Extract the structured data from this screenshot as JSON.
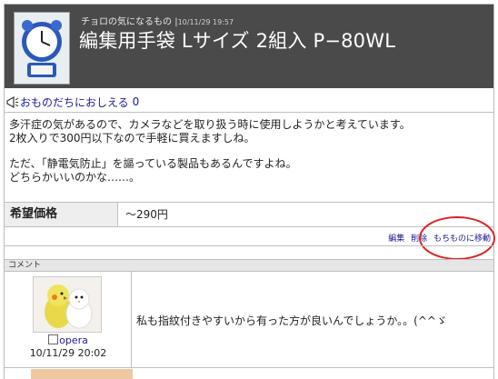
{
  "header": {
    "author": "チョロの気になるもの",
    "date": "10/11/29 19:57",
    "title": "編集用手袋 Lサイズ 2組入 P−80WL"
  },
  "tell": {
    "label": "おものだちにおしえる",
    "count": "0"
  },
  "body": {
    "paragraphs": [
      "多汗症の気があるので、カメラなどを取り扱う時に使用しようかと考えています。",
      "2枚入りで300円以下なので手軽に買えますしね。",
      "ただ、「静電気防止」を謳っている製品もあるんですよね。",
      "どちらかいいのかな……。"
    ]
  },
  "price": {
    "label": "希望価格",
    "value": "〜290円"
  },
  "actions": {
    "edit": "編集",
    "delete": "削除",
    "move": "もちものに移動"
  },
  "comments": {
    "header": "コメント",
    "items": [
      {
        "user": "opera",
        "date": "10/11/29 20:02",
        "text": "私も指紋付きやすいから有った方が良いんでしょうか。。(^^ゞ"
      }
    ]
  },
  "colors": {
    "header_bg": "#4a4a4a",
    "link": "#1b1b9a",
    "annotation": "#dd2222"
  }
}
